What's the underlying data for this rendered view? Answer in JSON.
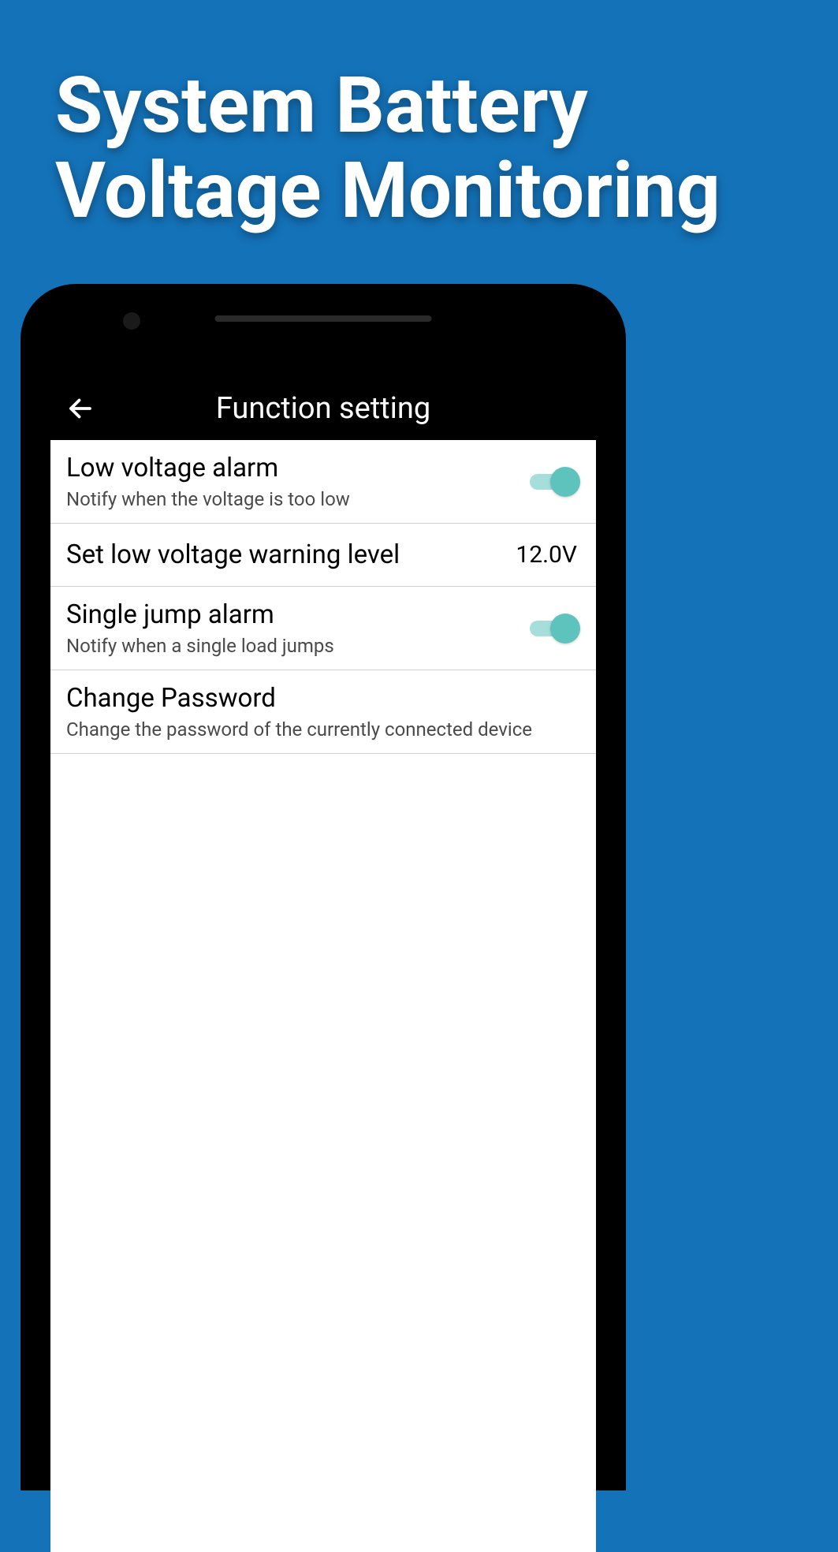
{
  "promo": {
    "title_line1": "System Battery",
    "title_line2": "Voltage Monitoring"
  },
  "header": {
    "title": "Function setting"
  },
  "settings": [
    {
      "title": "Low voltage alarm",
      "subtitle": "Notify when the voltage is too low",
      "type": "toggle",
      "value": true
    },
    {
      "title": "Set low voltage warning level",
      "type": "value",
      "value": "12.0V"
    },
    {
      "title": "Single jump alarm",
      "subtitle": "Notify when a single load jumps",
      "type": "toggle",
      "value": true
    },
    {
      "title": "Change Password",
      "subtitle": "Change the password of the currently connected device",
      "type": "link"
    }
  ],
  "colors": {
    "background": "#1472b8",
    "toggle_on": "#5fc3bd",
    "toggle_track": "#a6dedb"
  }
}
